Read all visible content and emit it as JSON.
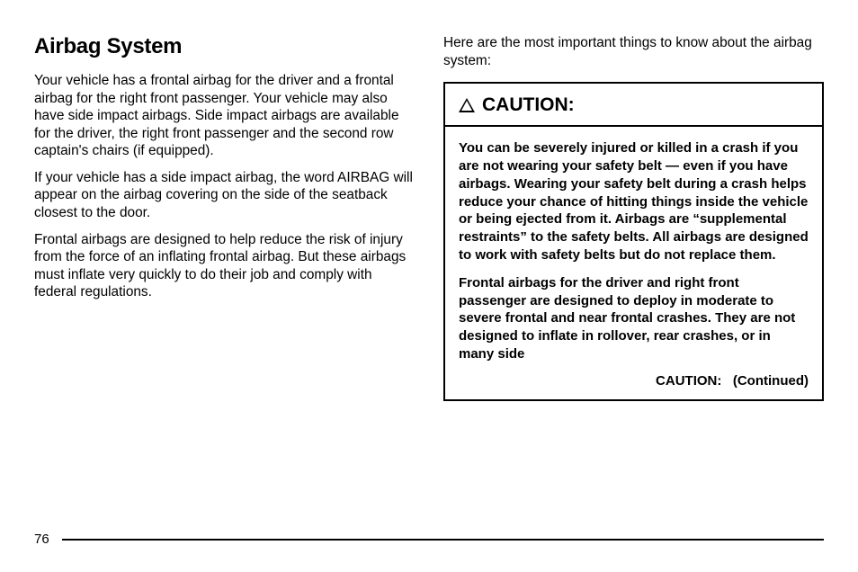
{
  "left": {
    "title": "Airbag System",
    "p1": "Your vehicle has a frontal airbag for the driver and a frontal airbag for the right front passenger. Your vehicle may also have side impact airbags. Side impact airbags are available for the driver, the right front passenger and the second row captain's chairs (if equipped).",
    "p2": "If your vehicle has a side impact airbag, the word AIRBAG will appear on the airbag covering on the side of the seatback closest to the door.",
    "p3": "Frontal airbags are designed to help reduce the risk of injury from the force of an inflating frontal airbag. But these airbags must inflate very quickly to do their job and comply with federal regulations."
  },
  "right": {
    "intro": "Here are the most important things to know about the airbag system:",
    "caution": {
      "title": "CAUTION:",
      "p1": "You can be severely injured or killed in a crash if you are not wearing your safety belt — even if you have airbags. Wearing your safety belt during a crash helps reduce your chance of hitting things inside the vehicle or being ejected from it. Airbags are “supplemental restraints” to the safety belts. All airbags are designed to work with safety belts but do not replace them.",
      "p2": "Frontal airbags for the driver and right front passenger are designed to deploy in moderate to severe frontal and near frontal crashes. They are not designed to inflate in rollover, rear crashes, or in many side",
      "continued": "CAUTION:   (Continued)"
    }
  },
  "pageNumber": "76"
}
